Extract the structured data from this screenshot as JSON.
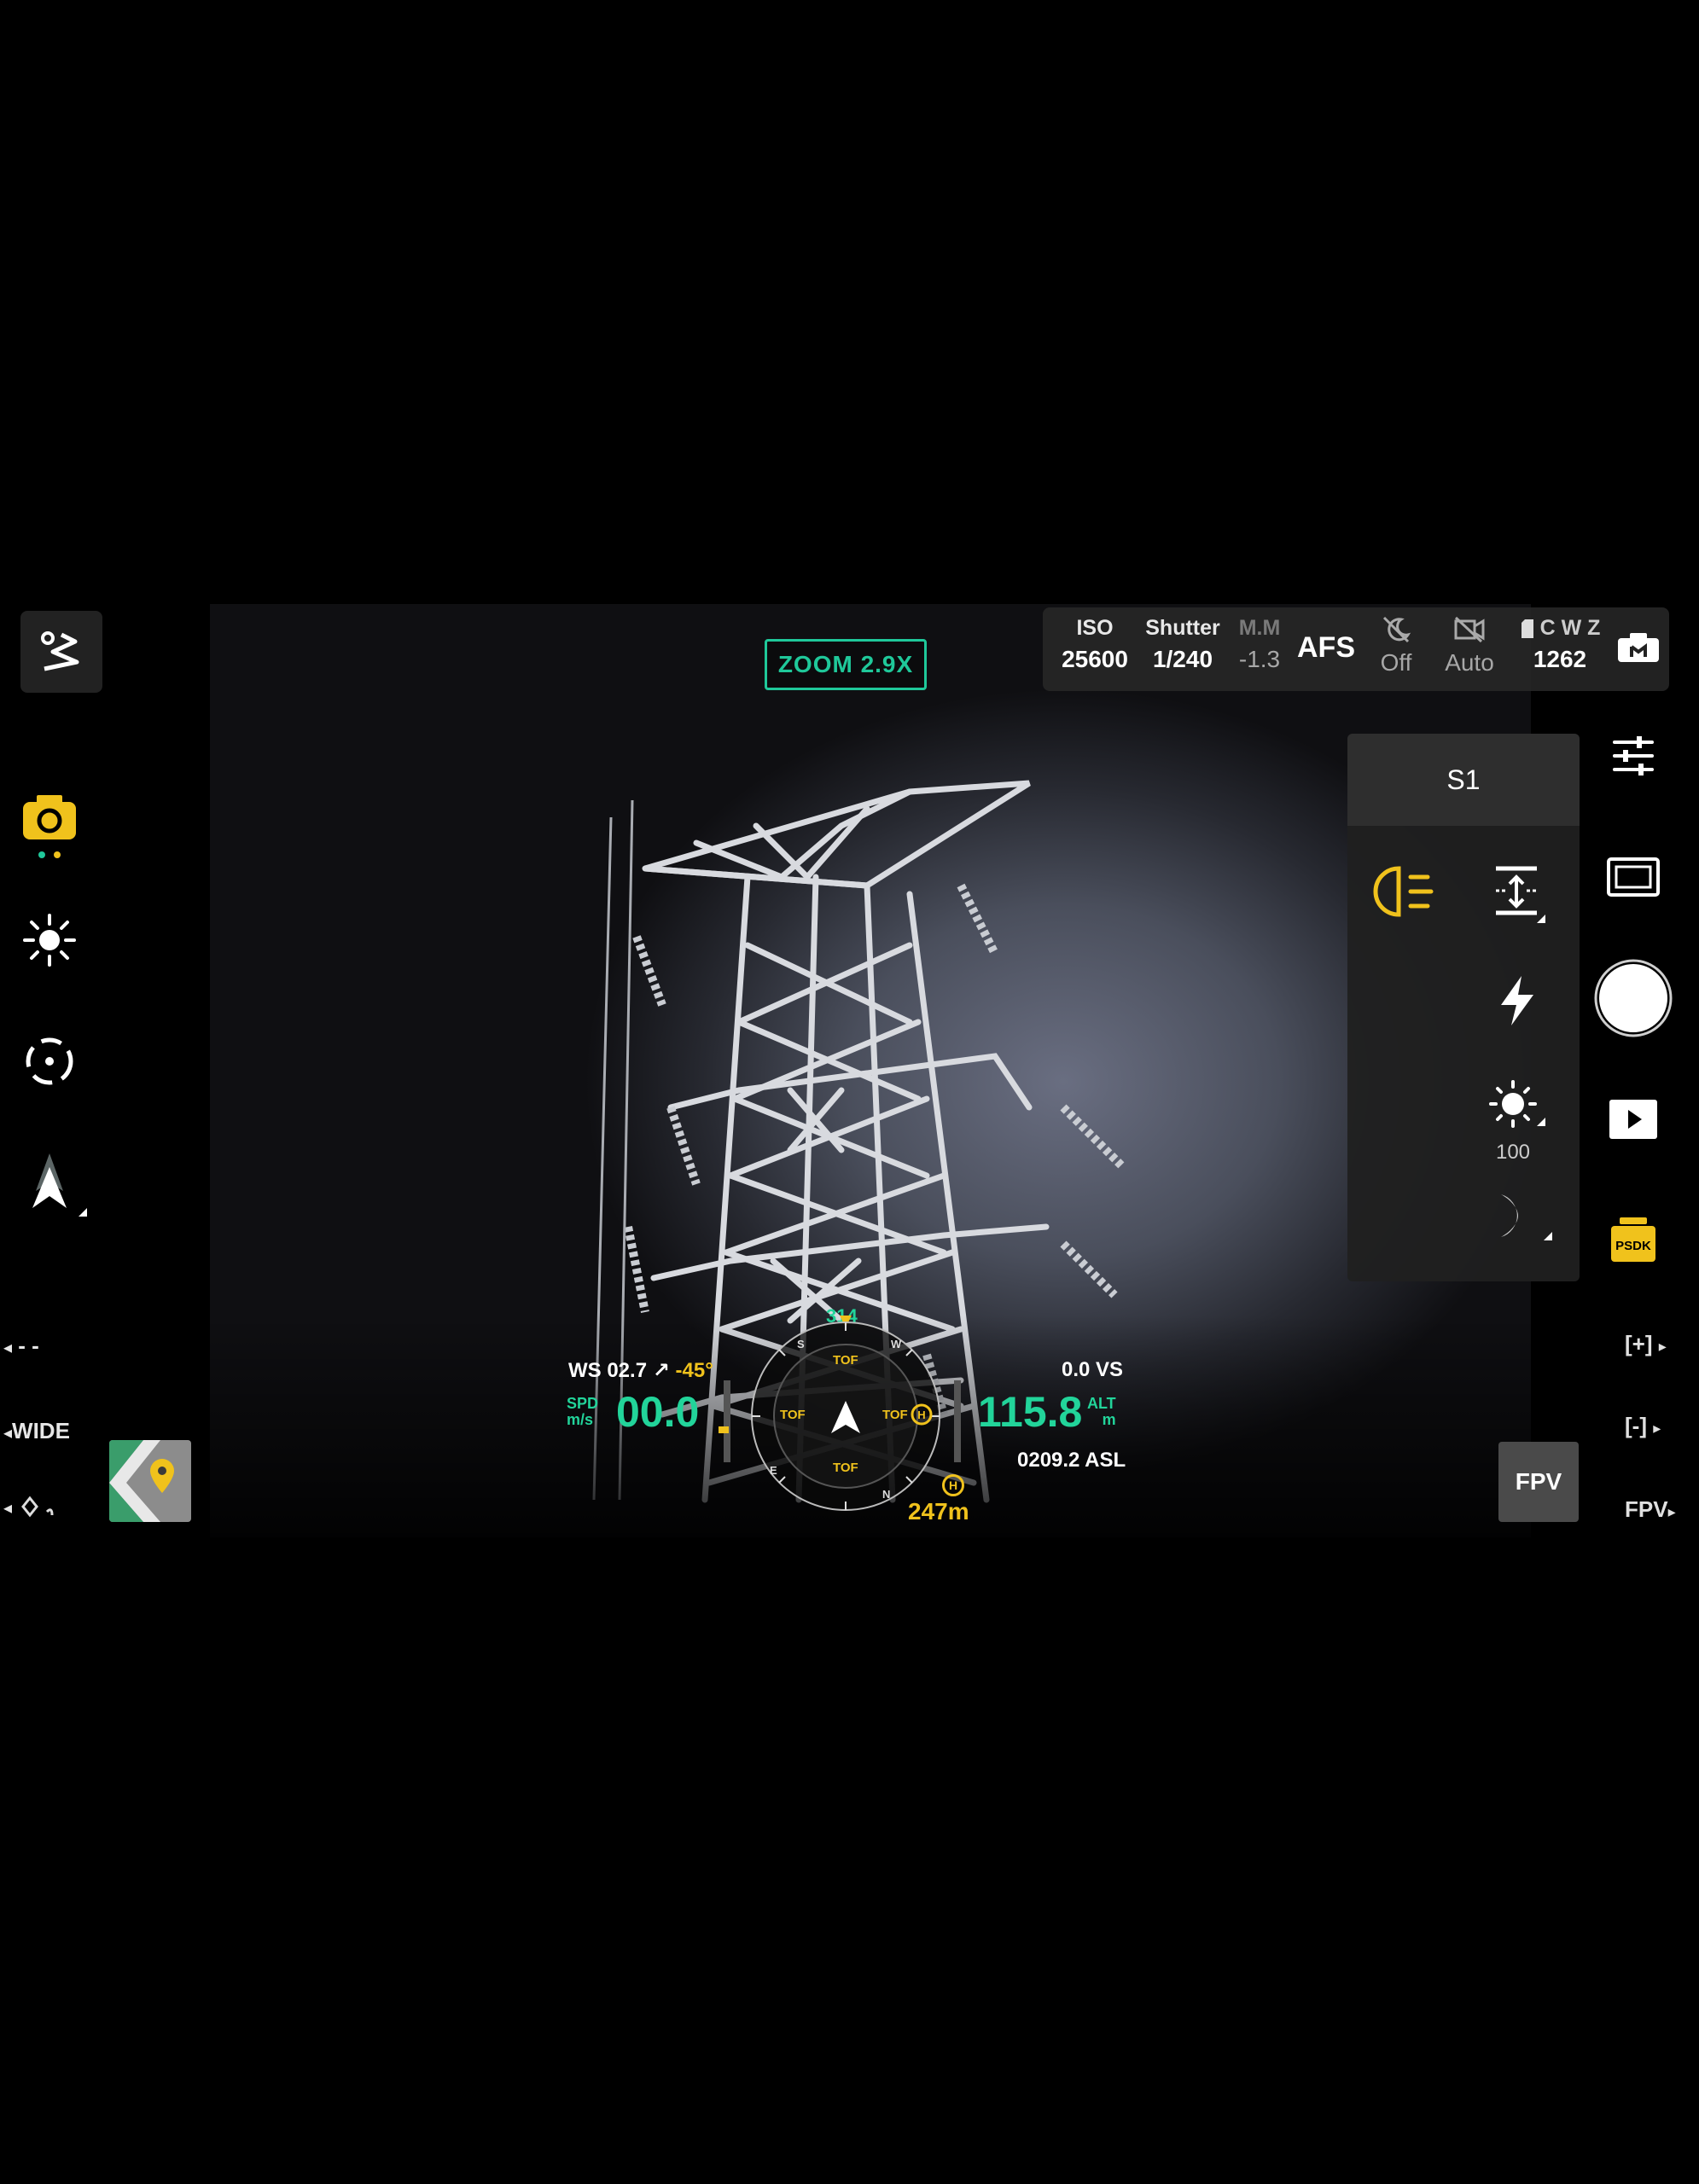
{
  "zoom": {
    "label": "ZOOM  2.9X"
  },
  "camera_params": {
    "iso_label": "ISO",
    "iso_value": "25600",
    "shutter_label": "Shutter",
    "shutter_value": "1/240",
    "mm_label": "M.M",
    "ev_value": "-1.3",
    "focus_mode": "AFS",
    "col5_value": "Off",
    "col6_value": "Auto",
    "storage_label": "C W Z",
    "storage_value": "1262",
    "icons": [
      "night-off-icon",
      "video-off-icon",
      "sd-card-icon",
      "camera-mode-icon"
    ]
  },
  "panel": {
    "header": "S1",
    "brightness_value": "100",
    "icons": [
      "spotlight-icon",
      "lift-icon",
      "strobe-icon",
      "brightness-icon",
      "speaker-icon"
    ]
  },
  "left_rail": {
    "lens_label": "WIDE",
    "dashes": "- -",
    "icons": [
      "route-icon",
      "camera-switch-icon",
      "sun-exposure-icon",
      "target-icon",
      "navigation-icon",
      "map-icon"
    ]
  },
  "right_rail": {
    "icons": [
      "settings-sliders-icon",
      "aspect-icon",
      "shutter-button-icon",
      "playback-icon",
      "psdk-icon"
    ],
    "psdk_label": "PSDK",
    "zoom_in_label": "[+]",
    "zoom_out_label": "[-]",
    "fpv_label": "FPV",
    "fpv_button_label": "FPV"
  },
  "osd": {
    "ws_text": "WS 02.7 ↗",
    "ws_angle": "-45°",
    "spd_label_top": "SPD",
    "spd_label_bottom": "m/s",
    "spd_value": "00.0",
    "vs_text": "0.0 VS",
    "alt_value": "115.8",
    "alt_label_top": "ALT",
    "alt_label_bottom": "m",
    "asl_text": "0209.2 ASL",
    "heading": "314",
    "home_distance": "247m",
    "compass_labels": [
      "TOF",
      "TOF",
      "TOF",
      "TOF"
    ],
    "home_marker": "H"
  },
  "colors": {
    "accent_green": "#1fc89a",
    "accent_yellow": "#f0c21c"
  }
}
